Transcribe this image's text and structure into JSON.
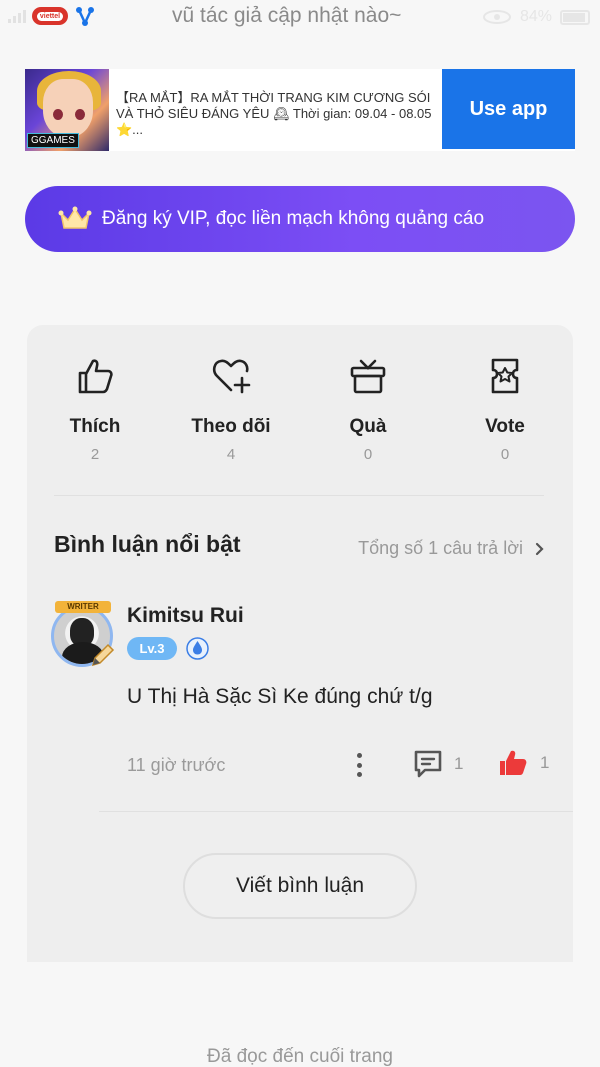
{
  "status_bar": {
    "carrier": "viettel",
    "title": "vũ tác giả cập nhật nào~",
    "battery": "84%"
  },
  "ad": {
    "text": "【RA MẮT】RA MẮT THỜI TRANG KIM CƯƠNG SÓI VÀ THỎ SIÊU ĐÁNG YÊU 🕰 Thời gian: 09.04 - 08.05 ⭐...",
    "badge": "GGAMES",
    "button": "Use app",
    "accent": "#1a74e8"
  },
  "vip_banner": {
    "label": "Đăng ký VIP, đọc liền mạch không quảng cáo",
    "color": "#6a45ee"
  },
  "actions": [
    {
      "label": "Thích",
      "count": "2",
      "icon": "thumbs-up-icon"
    },
    {
      "label": "Theo dõi",
      "count": "4",
      "icon": "heart-plus-icon"
    },
    {
      "label": "Quà",
      "count": "0",
      "icon": "gift-icon"
    },
    {
      "label": "Vote",
      "count": "0",
      "icon": "vote-ticket-icon"
    }
  ],
  "highlights": {
    "title": "Bình luận nổi bật",
    "total": "Tổng số 1 câu trả lời"
  },
  "comment": {
    "avatar_badge": "WRITER",
    "username": "Kimitsu Rui",
    "level": "Lv.3",
    "text": "U Thị Hà Sặc Sì Ke đúng chứ t/g",
    "time": "11 giờ trước",
    "replies": "1",
    "likes": "1"
  },
  "write_button": "Viết bình luận",
  "footer": "Đã đọc đến cuối trang"
}
